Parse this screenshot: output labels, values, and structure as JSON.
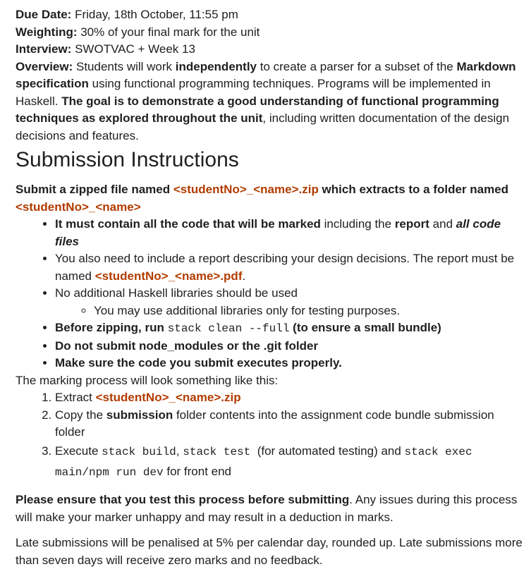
{
  "meta": {
    "due_label": "Due Date:",
    "due_value": " Friday, 18th October, 11:55 pm",
    "weight_label": "Weighting:",
    "weight_value": " 30% of your final mark for the unit",
    "interview_label": "Interview:",
    "interview_value": " SWOTVAC + Week 13"
  },
  "overview": {
    "label": "Overview:",
    "t1": " Students will work ",
    "b1": "independently",
    "t2": " to create a parser for a subset of the ",
    "b2": "Markdown specification",
    "t3": " using functional programming techniques. Programs will be implemented in Haskell. ",
    "b3": "The goal is to demonstrate a good understanding of functional programming techniques as explored throughout the unit",
    "t4": ", including written documentation of the design decisions and features."
  },
  "submission": {
    "heading": "Submission Instructions",
    "intro_b1": "Submit a zipped file named ",
    "intro_hl1": "<studentNo>_<name>.zip",
    "intro_b2": " which extracts to a folder named ",
    "intro_hl2": "<studentNo>_<name>",
    "b1_bold": "It must contain all the code that will be marked",
    "b1_t": " including the ",
    "b1_bold2": "report",
    "b1_t2": " and ",
    "b1_it": "all code files",
    "b2_t": "You also need to include a report describing your design decisions. The report must be named ",
    "b2_hl": "<studentNo>_<name>.pdf",
    "b2_end": ".",
    "b3_t": "No additional Haskell libraries should be used",
    "b3_sub": "You may use additional libraries only for testing purposes.",
    "b4_b1": "Before zipping, run ",
    "b4_code": "stack clean --full",
    "b4_b2": " (to ensure a small bundle)",
    "b5": "Do not submit node_modules or the .git folder",
    "b6": "Make sure the code you submit executes properly."
  },
  "process": {
    "intro": "The marking process will look something like this:",
    "s1_t": "Extract ",
    "s1_hl": "<studentNo>_<name>.zip",
    "s2_t1": "Copy the ",
    "s2_b": "submission",
    "s2_t2": " folder contents into the assignment code bundle submission folder",
    "s3_t1": "Execute ",
    "s3_c1": "stack build",
    "s3_t2": ", ",
    "s3_c2": "stack test",
    "s3_t3": "  (for automated testing) and ",
    "s3_c3": "stack exec main/npm run dev",
    "s3_t4": " for front end"
  },
  "footer": {
    "p1_b": "Please ensure that you test this process before submitting",
    "p1_t": ". Any issues during this process will make your marker unhappy and may result in a deduction in marks.",
    "p2": "Late submissions will be penalised at 5% per calendar day, rounded up. Late submissions more than seven days will receive zero marks and no feedback."
  }
}
